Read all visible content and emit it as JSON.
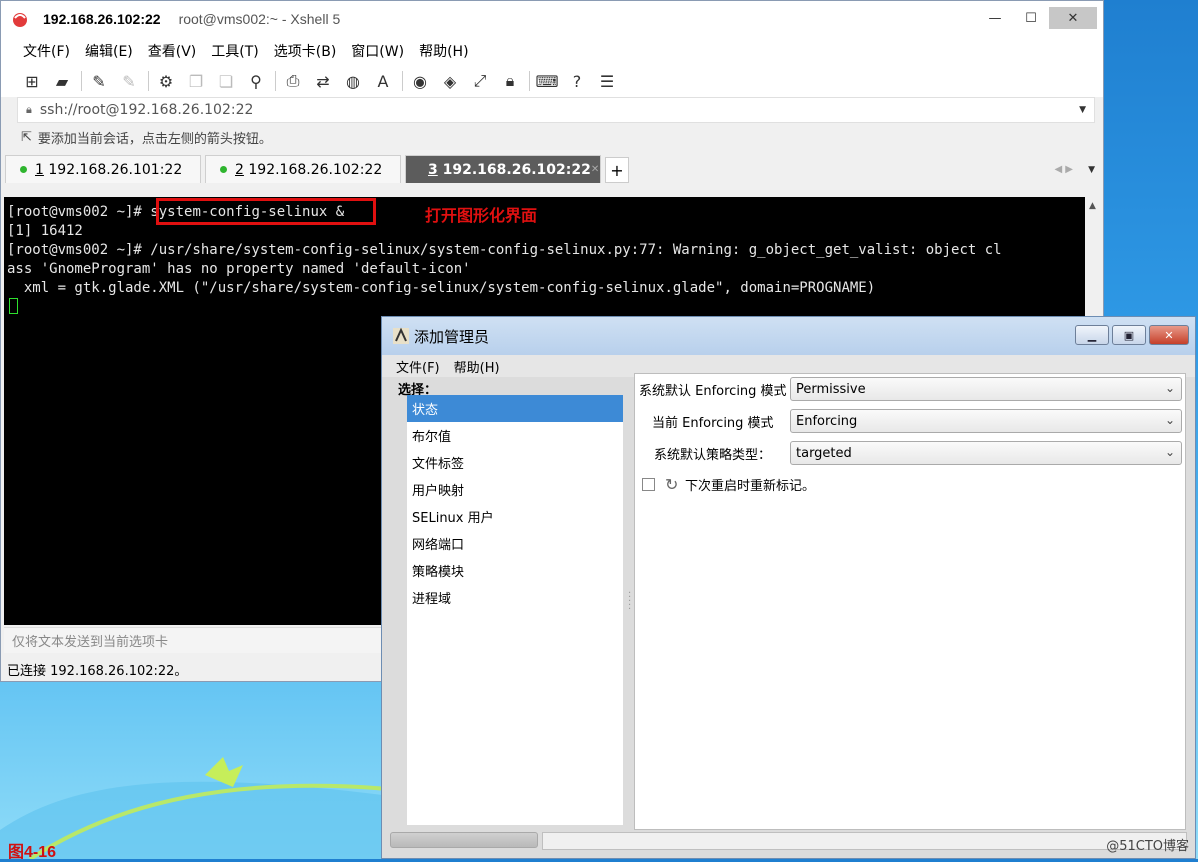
{
  "xshell": {
    "title_ip": "192.168.26.102:22",
    "title_sub": "root@vms002:~ - Xshell 5",
    "menu": [
      "文件(F)",
      "编辑(E)",
      "查看(V)",
      "工具(T)",
      "选项卡(B)",
      "窗口(W)",
      "帮助(H)"
    ],
    "address": "ssh://root@192.168.26.102:22",
    "hint": "要添加当前会话，点击左侧的箭头按钮。",
    "tabs": [
      {
        "num": "1",
        "label": "192.168.26.101:22"
      },
      {
        "num": "2",
        "label": "192.168.26.102:22"
      },
      {
        "num": "3",
        "label": "192.168.26.102:22"
      }
    ],
    "terminal": {
      "line1_prompt": "[root@vms002 ~]#",
      "line1_cmd": "system-config-selinux &",
      "line2": "[1] 16412",
      "line3": "[root@vms002 ~]# /usr/share/system-config-selinux/system-config-selinux.py:77: Warning: g_object_get_valist: object cl",
      "line4": "ass 'GnomeProgram' has no property named 'default-icon'",
      "line5": "  xml = gtk.glade.XML (\"/usr/share/system-config-selinux/system-config-selinux.glade\", domain=PROGNAME)"
    },
    "annotation": "打开图形化界面",
    "send_bar": "仅将文本发送到当前选项卡",
    "status": "已连接 192.168.26.102:22。"
  },
  "dialog": {
    "title": "添加管理员",
    "menu": [
      "文件(F)",
      "帮助(H)"
    ],
    "select_label": "选择：",
    "items": [
      "状态",
      "布尔值",
      "文件标签",
      "用户映射",
      "SELinux 用户",
      "网络端口",
      "策略模块",
      "进程域"
    ],
    "selected_index": 0,
    "fields": [
      {
        "label": "系统默认 Enforcing 模式",
        "value": "Permissive"
      },
      {
        "label": "当前 Enforcing 模式",
        "value": "Enforcing"
      },
      {
        "label": "系统默认策略类型：",
        "value": "targeted"
      }
    ],
    "relabel": "下次重启时重新标记。",
    "watermark": "@51CTO博客"
  },
  "figure_label": "图4-16",
  "colors": {
    "annotation_red": "#e01010",
    "selection_blue": "#3d8ad6",
    "status_green": "#2fb52f"
  }
}
